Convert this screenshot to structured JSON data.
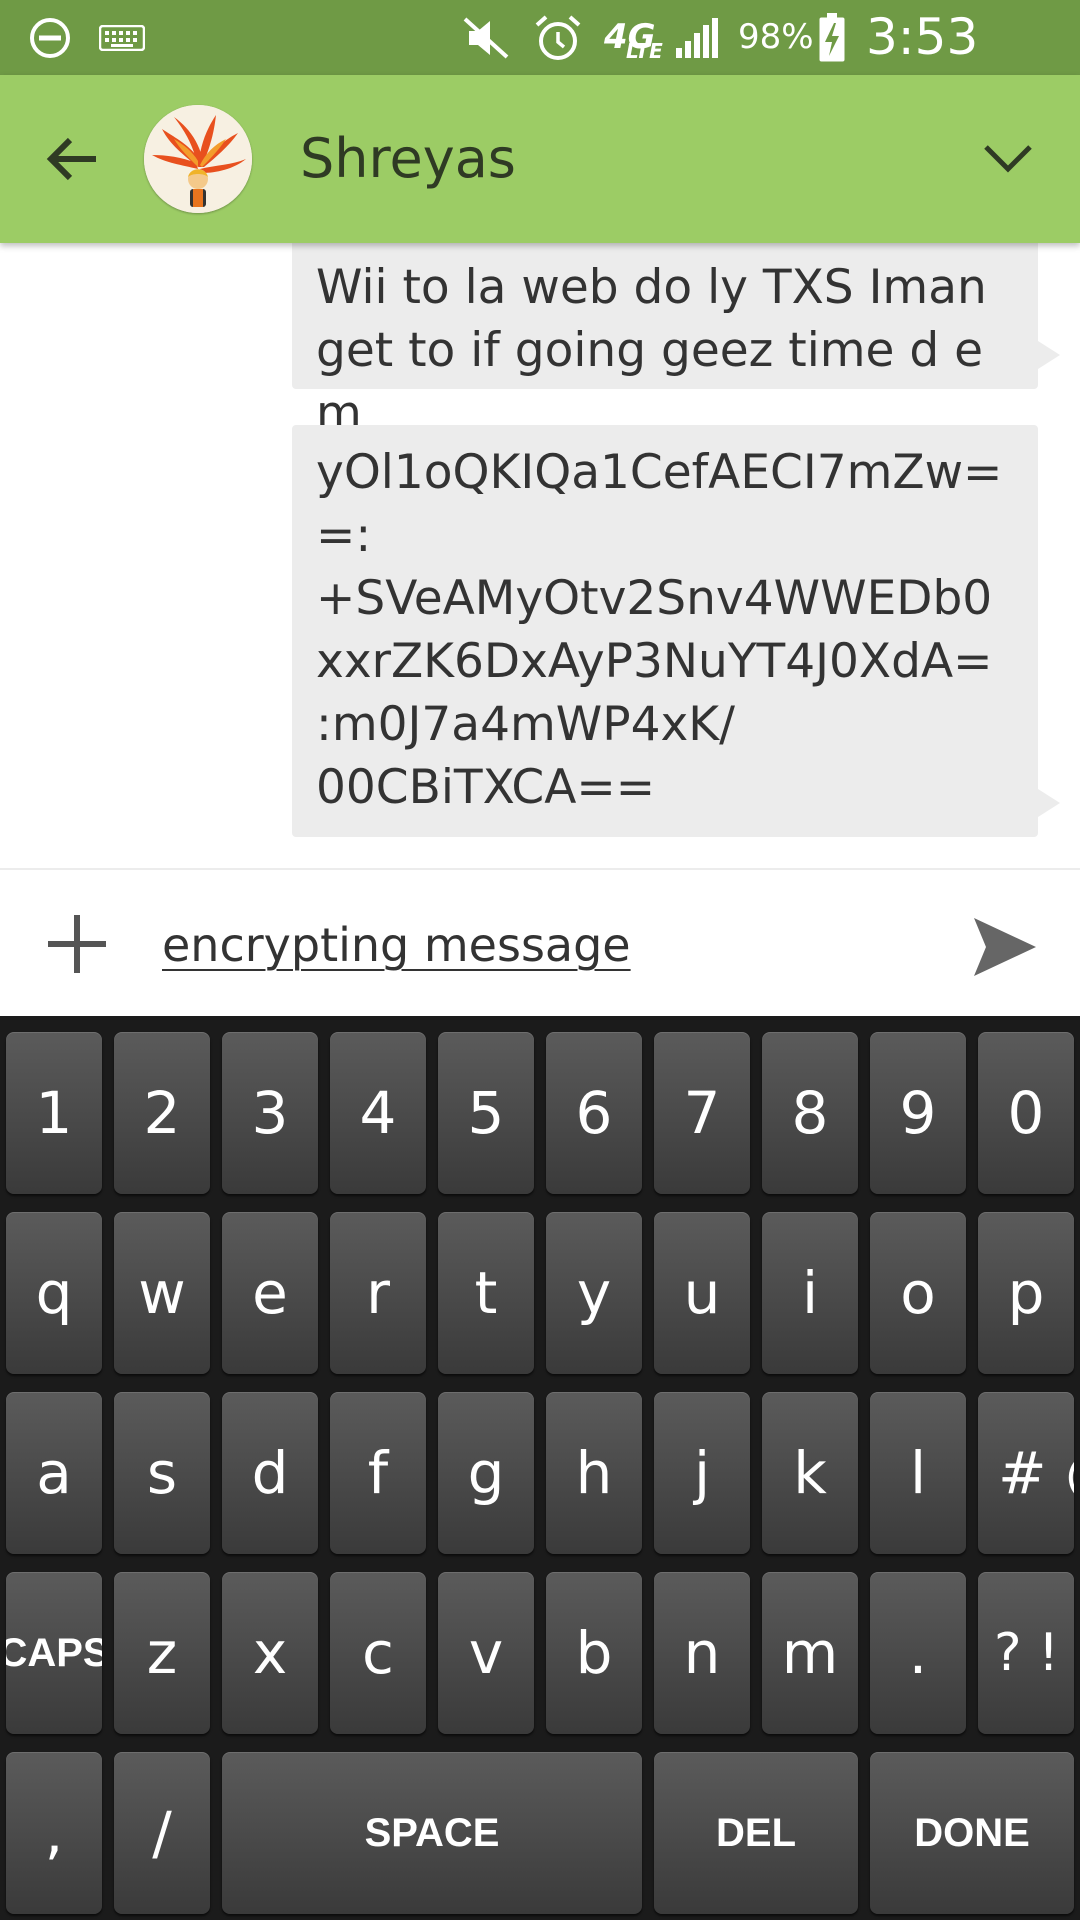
{
  "status_bar": {
    "icons": [
      "do-not-disturb-icon",
      "keyboard-icon",
      "mute-icon",
      "alarm-icon",
      "4g-lte-icon",
      "signal-icon",
      "battery-charging-icon"
    ],
    "network": "4G",
    "network_sub": "LTE",
    "battery": "98%",
    "time": "3:53 AM"
  },
  "header": {
    "contact_name": "Shreyas",
    "icons": [
      "back-arrow-icon",
      "avatar",
      "chevron-down-icon"
    ],
    "colors": {
      "bar": "#9ccc65",
      "status_bar": "#6f9a45"
    }
  },
  "messages": [
    {
      "text": "Wii to la web do ly TXS Iman get to if going geez time d em"
    },
    {
      "text": "yOl1oQKIQa1CefAECI7mZw=\n=:\n+SVeAMyOtv2Snv4WWEDb0\nxxrZK6DxAyP3NuYT4J0XdA=\n:m0J7a4mWP4xK/\n00CBiTXCA=="
    }
  ],
  "compose": {
    "value": "encrypting message",
    "icons": [
      "plus-icon",
      "send-icon"
    ]
  },
  "keyboard": {
    "rows": [
      [
        "1",
        "2",
        "3",
        "4",
        "5",
        "6",
        "7",
        "8",
        "9",
        "0"
      ],
      [
        "q",
        "w",
        "e",
        "r",
        "t",
        "y",
        "u",
        "i",
        "o",
        "p"
      ],
      [
        "a",
        "s",
        "d",
        "f",
        "g",
        "h",
        "j",
        "k",
        "l",
        "# @"
      ],
      [
        "CAPS",
        "z",
        "x",
        "c",
        "v",
        "b",
        "n",
        "m",
        ".",
        "? ! :"
      ],
      [
        ",",
        "/",
        "SPACE",
        "DEL",
        "DONE"
      ]
    ]
  }
}
